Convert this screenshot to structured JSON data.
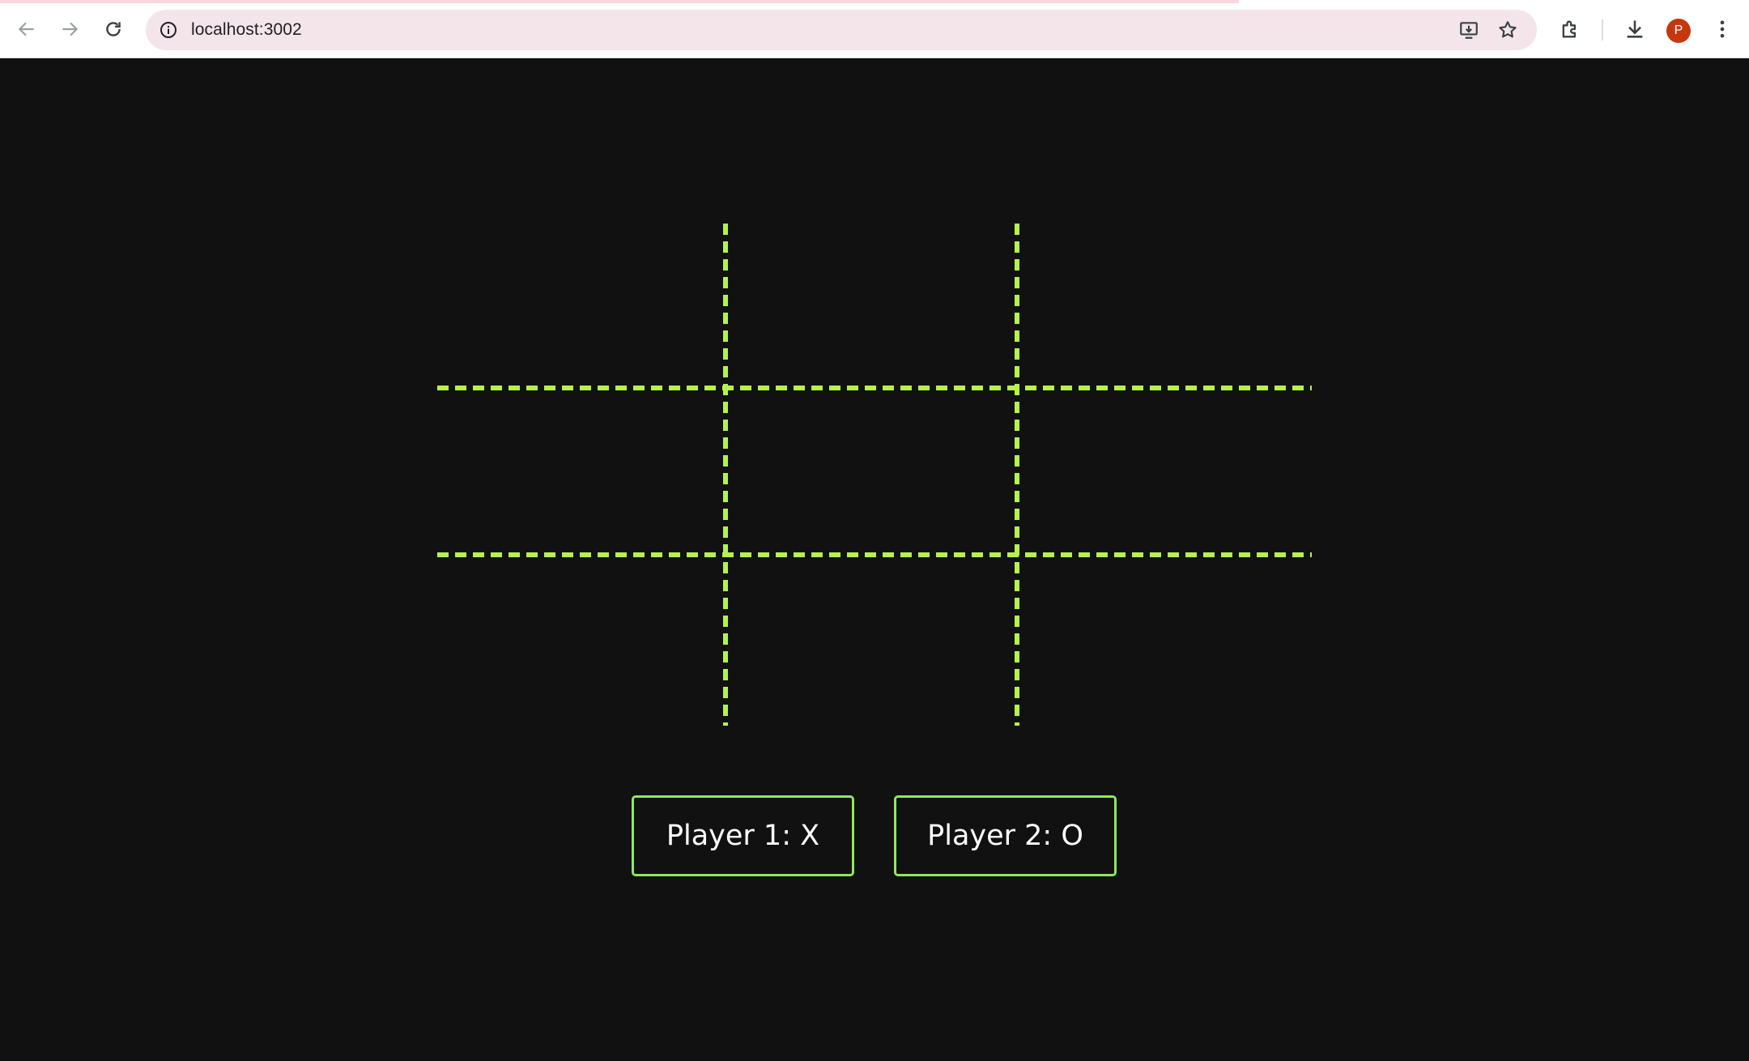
{
  "browser": {
    "url": "localhost:3002",
    "profile_initial": "P",
    "icons": {
      "back": "arrow-left-icon",
      "forward": "arrow-right-icon",
      "reload": "reload-icon",
      "site_info": "info-icon",
      "install": "install-app-icon",
      "bookmark": "star-icon",
      "extensions": "puzzle-icon",
      "downloads": "download-icon",
      "menu": "kebab-menu-icon"
    },
    "accent_color": "#c5380e"
  },
  "game": {
    "grid_color": "#b6f24a",
    "button_border_color": "#8fe85a",
    "cells": [
      "",
      "",
      "",
      "",
      "",
      "",
      "",
      "",
      ""
    ],
    "players": [
      {
        "label": "Player 1: X"
      },
      {
        "label": "Player 2: O"
      }
    ]
  }
}
